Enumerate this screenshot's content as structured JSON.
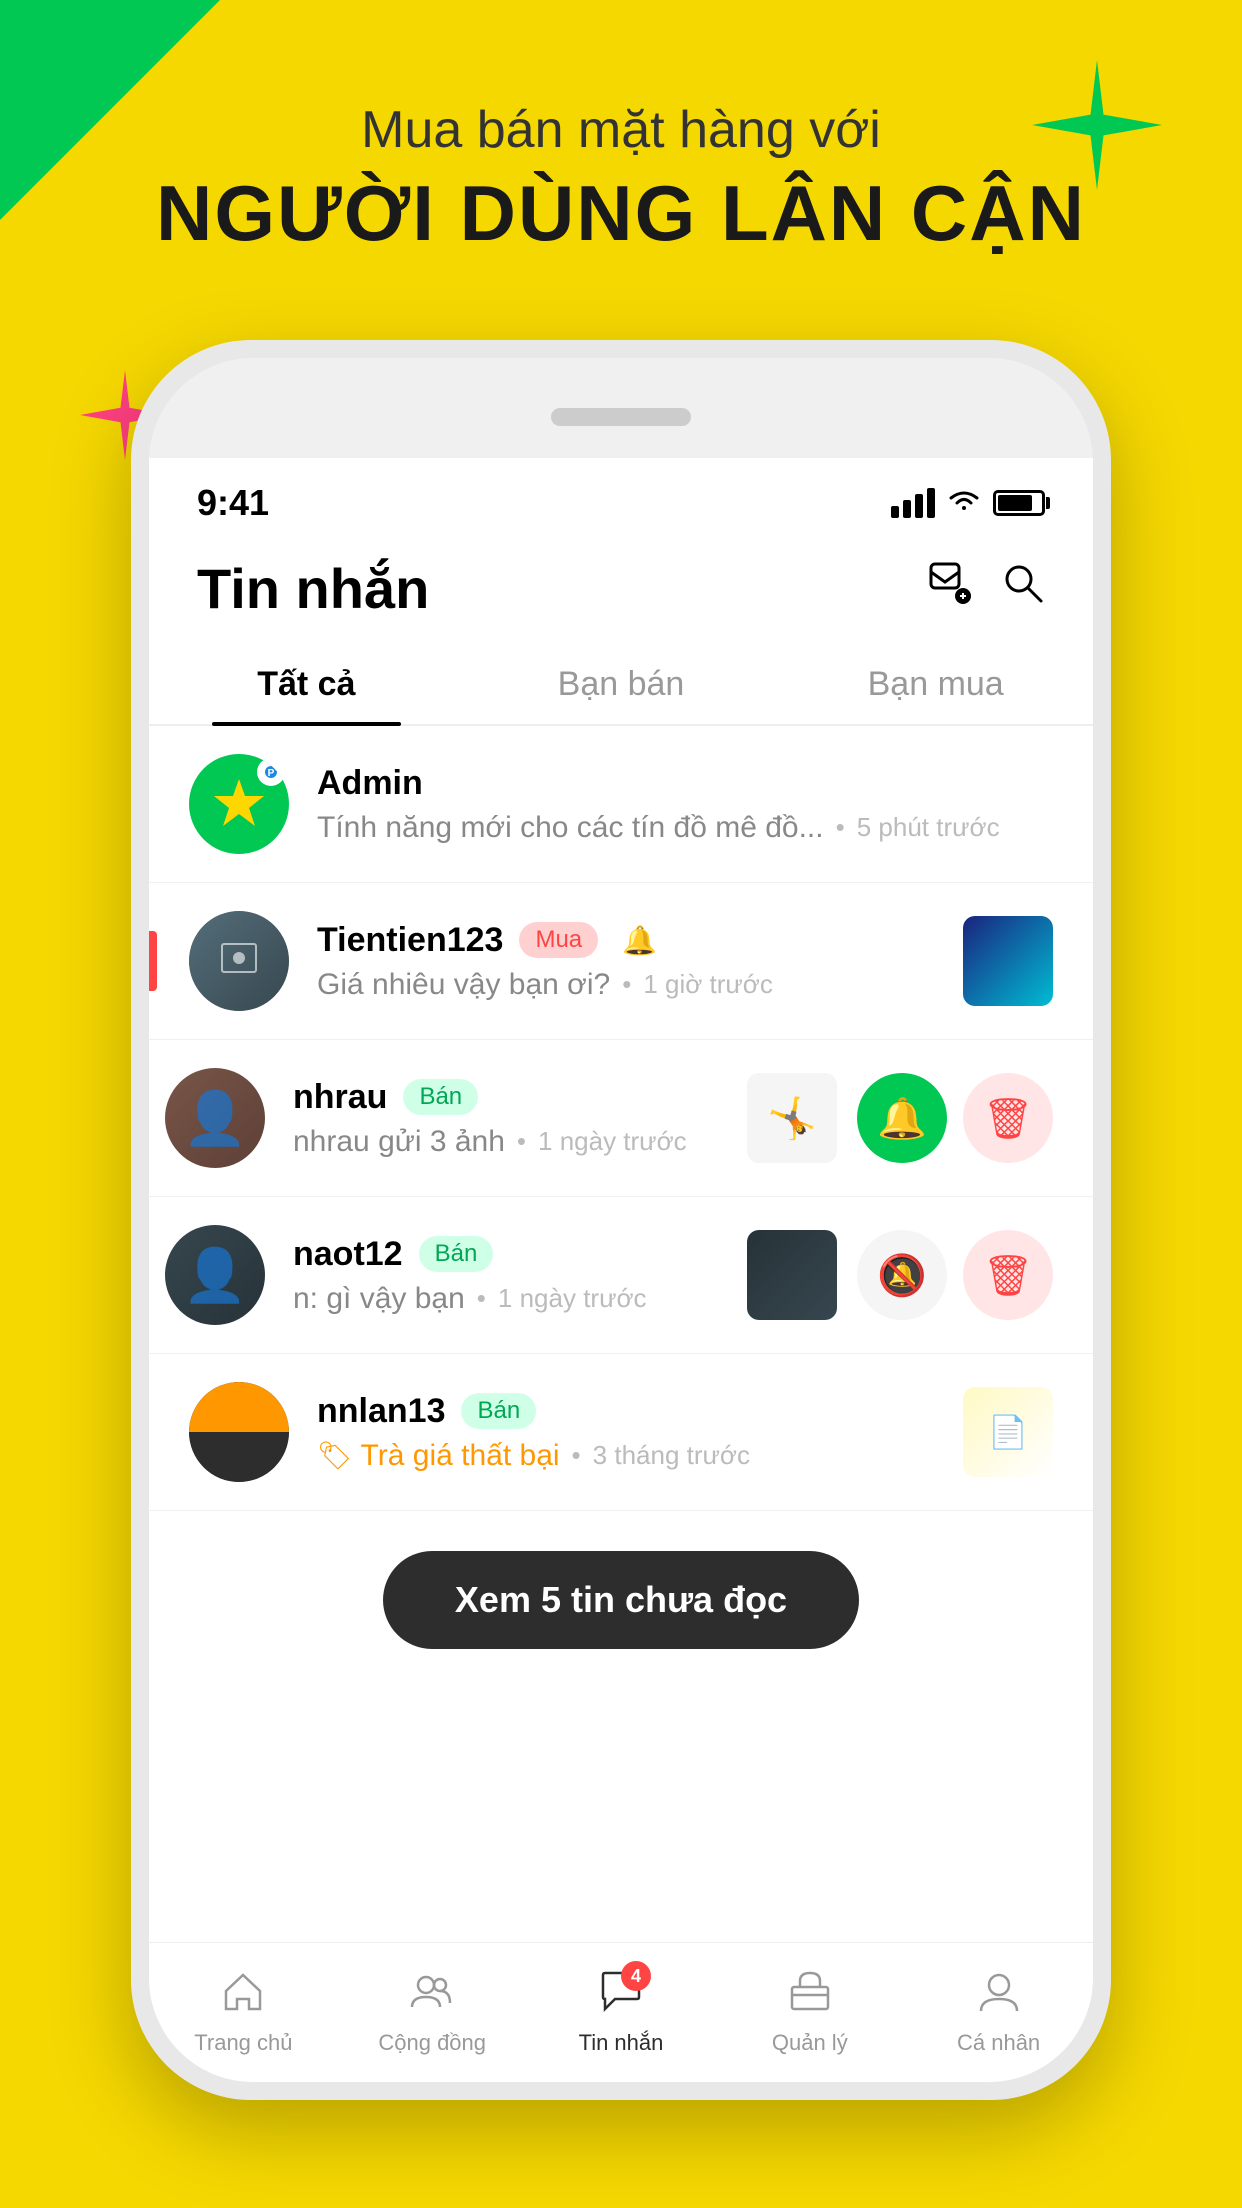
{
  "header": {
    "sub_title": "Mua bán mặt hàng với",
    "main_title": "NGƯỜI DÙNG LÂN CẬN"
  },
  "status_bar": {
    "time": "9:41",
    "signal_level": 3,
    "wifi": true,
    "battery": 80
  },
  "app_header": {
    "title": "Tin nhắn",
    "compose_icon": "✏",
    "search_icon": "🔍"
  },
  "tabs": [
    {
      "id": "all",
      "label": "Tất cả",
      "active": true
    },
    {
      "id": "seller",
      "label": "Bạn bán",
      "active": false
    },
    {
      "id": "buyer",
      "label": "Bạn mua",
      "active": false
    }
  ],
  "messages": [
    {
      "id": 1,
      "avatar_type": "admin",
      "name": "Admin",
      "preview": "Tính năng mới cho các tín đồ mê đồ...",
      "time": "5 phút trước",
      "has_thumbnail": false,
      "has_actions": false
    },
    {
      "id": 2,
      "avatar_type": "person",
      "name": "Tientien123",
      "tag": "Mua",
      "tag_type": "buy",
      "muted": true,
      "preview": "Giá nhiêu vậy bạn ơi?",
      "time": "1 giờ trước",
      "has_thumbnail": true,
      "thumb_type": "blue",
      "has_actions": false
    },
    {
      "id": 3,
      "avatar_type": "person",
      "name": "nhrau",
      "tag": "Bán",
      "tag_type": "sell",
      "preview": "nhrau gửi 3 ảnh",
      "time": "1 ngày trước",
      "has_thumbnail": true,
      "thumb_type": "white",
      "has_actions": true,
      "has_left_indicator": true
    },
    {
      "id": 4,
      "avatar_type": "person",
      "name": "naot12",
      "tag": "Bán",
      "tag_type": "sell",
      "preview": "n: gì vậy bạn",
      "time": "1 ngày trước",
      "has_thumbnail": true,
      "thumb_type": "circuit",
      "has_actions": true
    },
    {
      "id": 5,
      "avatar_type": "person",
      "name": "nnlan13",
      "tag": "Bán",
      "tag_type": "sell",
      "price_tag": "Trà giá thất bại",
      "time": "3 tháng trước",
      "has_thumbnail": true,
      "thumb_type": "papers",
      "has_actions": false
    }
  ],
  "unread_button": {
    "label": "Xem 5 tin chưa đọc"
  },
  "bottom_nav": [
    {
      "id": "home",
      "label": "Trang chủ",
      "icon": "home",
      "active": false
    },
    {
      "id": "community",
      "label": "Cộng đồng",
      "icon": "people",
      "active": false
    },
    {
      "id": "messages",
      "label": "Tin nhắn",
      "icon": "chat",
      "active": true,
      "badge": "4"
    },
    {
      "id": "manage",
      "label": "Quản lý",
      "icon": "store",
      "active": false
    },
    {
      "id": "profile",
      "label": "Cá nhân",
      "icon": "person",
      "active": false
    }
  ]
}
